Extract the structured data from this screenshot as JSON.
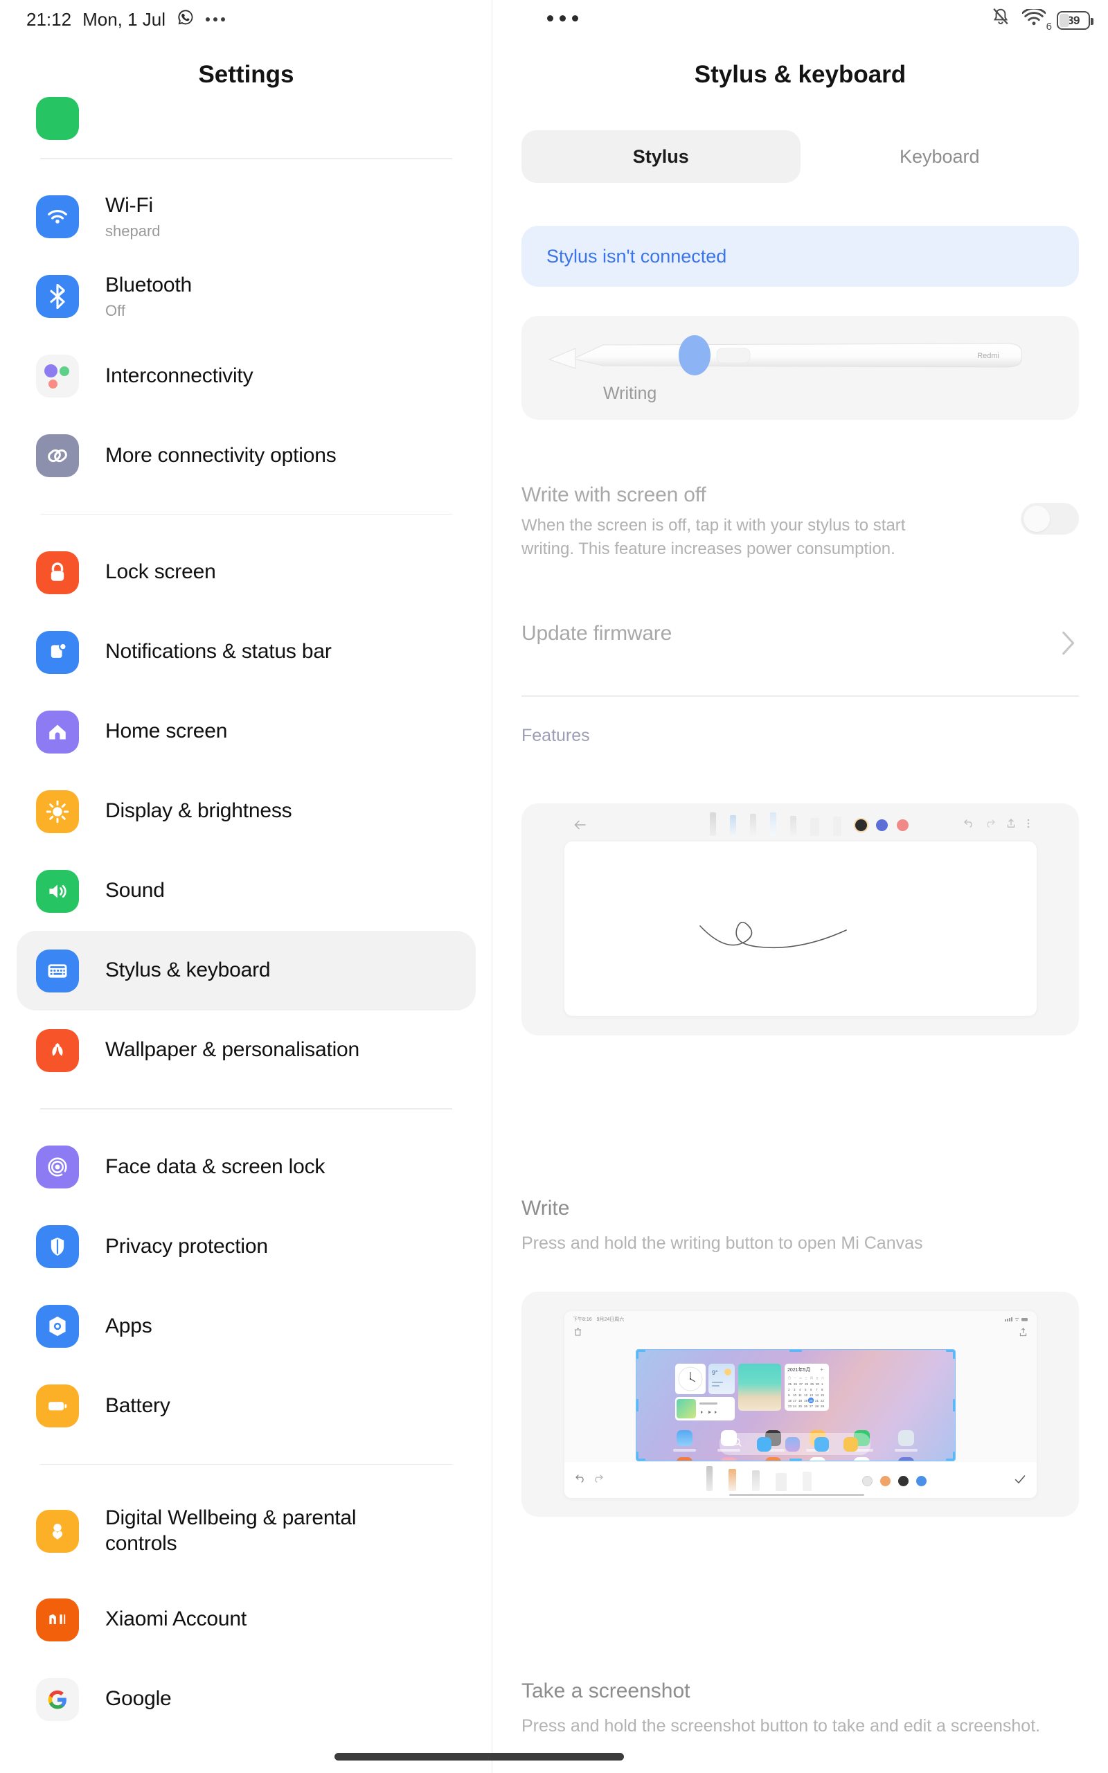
{
  "status_bar": {
    "time": "21:12",
    "date": "Mon, 1 Jul",
    "left_icons": [
      "whatsapp-icon",
      "overflow-dots-icon"
    ],
    "center_icon": "overflow-dots-icon",
    "right_icons": [
      "bell-muted-icon",
      "wifi-6-icon",
      "battery-icon"
    ],
    "battery_level": "39",
    "wifi_label": "6"
  },
  "sidebar": {
    "title": "Settings",
    "items": [
      {
        "label": "",
        "sub": "",
        "icon": "green-app-icon",
        "group": 0,
        "clipped": true
      },
      {
        "label": "Wi-Fi",
        "sub": "shepard",
        "icon": "wifi-icon",
        "group": 1,
        "color": "#3a86f4"
      },
      {
        "label": "Bluetooth",
        "sub": "Off",
        "icon": "bluetooth-icon",
        "group": 1,
        "color": "#3a86f4"
      },
      {
        "label": "Interconnectivity",
        "sub": "",
        "icon": "interconnectivity-dots-icon",
        "group": 1,
        "color": "#f4f4f4"
      },
      {
        "label": "More connectivity options",
        "sub": "",
        "icon": "link-icon",
        "group": 1,
        "color": "#8c90ad"
      },
      {
        "label": "Lock screen",
        "sub": "",
        "icon": "lock-icon",
        "group": 2,
        "color": "#f8542a"
      },
      {
        "label": "Notifications & status bar",
        "sub": "",
        "icon": "notification-icon",
        "group": 2,
        "color": "#3a86f4"
      },
      {
        "label": "Home screen",
        "sub": "",
        "icon": "home-icon",
        "group": 2,
        "color": "#8c7bf2"
      },
      {
        "label": "Display & brightness",
        "sub": "",
        "icon": "brightness-icon",
        "group": 2,
        "color": "#fcb028"
      },
      {
        "label": "Sound",
        "sub": "",
        "icon": "sound-icon",
        "group": 2,
        "color": "#26c462"
      },
      {
        "label": "Stylus & keyboard",
        "sub": "",
        "icon": "keyboard-icon",
        "group": 2,
        "color": "#3a86f4",
        "selected": true
      },
      {
        "label": "Wallpaper & personalisation",
        "sub": "",
        "icon": "flower-icon",
        "group": 2,
        "color": "#f8542a"
      },
      {
        "label": "Face data & screen lock",
        "sub": "",
        "icon": "fingerprint-icon",
        "group": 3,
        "color": "#8c7bf2"
      },
      {
        "label": "Privacy protection",
        "sub": "",
        "icon": "shield-icon",
        "group": 3,
        "color": "#3a86f4"
      },
      {
        "label": "Apps",
        "sub": "",
        "icon": "apps-hexagon-icon",
        "group": 3,
        "color": "#3a86f4"
      },
      {
        "label": "Battery",
        "sub": "",
        "icon": "battery-icon",
        "group": 3,
        "color": "#fcb028"
      },
      {
        "label": "Digital Wellbeing & parental controls",
        "sub": "",
        "icon": "wellbeing-person-icon",
        "group": 4,
        "color": "#fcb028"
      },
      {
        "label": "Xiaomi Account",
        "sub": "",
        "icon": "mi-logo-icon",
        "group": 4,
        "color": "#f2600c"
      },
      {
        "label": "Google",
        "sub": "",
        "icon": "google-g-icon",
        "group": 4,
        "color": "#f4f4f4",
        "clipped_bottom": true
      }
    ]
  },
  "detail": {
    "title": "Stylus & keyboard",
    "tabs": [
      {
        "label": "Stylus",
        "active": true
      },
      {
        "label": "Keyboard",
        "active": false
      }
    ],
    "banner": {
      "text": "Stylus isn't connected",
      "color": "#3b74e8",
      "bg": "#e8f0fe"
    },
    "pen_card": {
      "brand": "Redmi",
      "button_label": "Writing",
      "button_color": "#8cb4f5"
    },
    "rows": [
      {
        "title": "Write with screen off",
        "desc": "When the screen is off, tap it with your stylus to start writing. This feature increases power consumption.",
        "control": "toggle",
        "toggle_on": false,
        "disabled": true
      },
      {
        "title": "Update firmware",
        "desc": "",
        "control": "chevron",
        "disabled": true
      }
    ],
    "features_label": "Features",
    "features": [
      {
        "caption_title": "Write",
        "caption_desc": "Press and hold the writing button to open Mi Canvas",
        "illustration": "mi-canvas-mock"
      },
      {
        "caption_title": "Take a screenshot",
        "caption_desc": "Press and hold the screenshot button to take and edit a screenshot.",
        "illustration": "screenshot-editor-mock"
      }
    ]
  },
  "colors": {
    "accent_blue": "#3b74e8",
    "banner_bg": "#e8f0fe",
    "card_bg": "#f5f5f5",
    "selected_bg": "#f2f2f2",
    "muted_text": "#b3b3b3",
    "divider": "#ececec"
  }
}
